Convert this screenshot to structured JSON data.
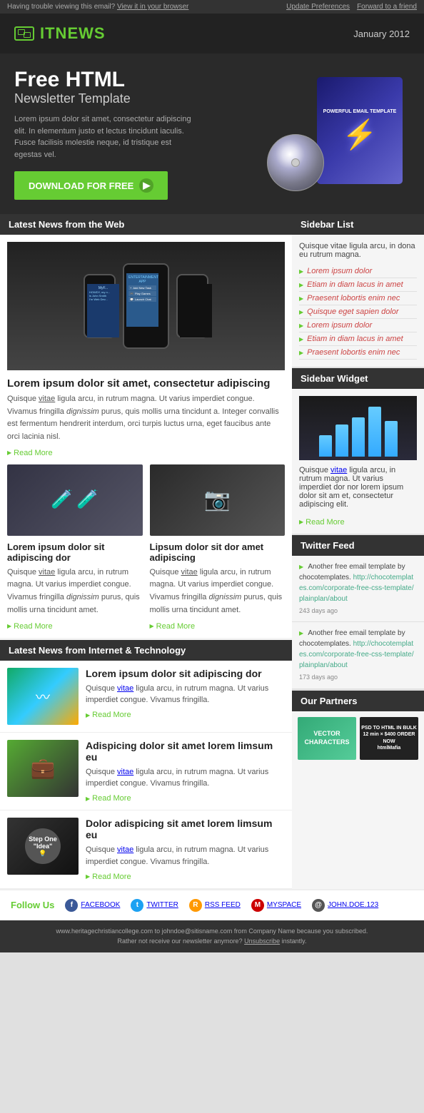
{
  "topBar": {
    "trouble_text": "Having trouble viewing this email?",
    "view_link": "View it in your browser",
    "update_link": "Update Preferences",
    "forward_link": "Forward to a friend"
  },
  "header": {
    "logo_text": "ITNEWS",
    "date": "January 2012"
  },
  "hero": {
    "title_line1": "Free HTML",
    "subtitle": "Newsletter Template",
    "description": "Lorem ipsum dolor sit amet, consectetur adipiscing elit. In elementum justo et lectus tincidunt iaculis. Fusce facilisis molestie neque, id tristique est egestas vel.",
    "button_label": "DOWNLOAD FOR FREE",
    "product_label": "POWERFUL EMAIL TEMPLATE"
  },
  "latestNews": {
    "section_title": "Latest News from the Web",
    "main_article": {
      "title": "Lorem ipsum dolor sit amet, consectetur adipiscing",
      "text": "Quisque vitae ligula arcu, in rutrum magna. Ut varius imperdiet congue. Vivamus fringilla dignissim purus, quis mollis urna tincidunt a. Integer convallis est fermentum hendrerit interdum, orci turpis luctus urna, eget faucibus ante orci lacinia nisl.",
      "read_more": "Read More",
      "vitae_link": "vitae"
    },
    "article1": {
      "title": "Lorem ipsum dolor sit adipiscing dor",
      "text": "Quisque vitae ligula arcu, in rutrum magna. Ut varius imperdiet congue. Vivamus fringilla dignissim purus, quis mollis urna tincidunt amet.",
      "read_more": "Read More",
      "vitae_link": "vitae"
    },
    "article2": {
      "title": "Lipsum dolor sit dor amet adipiscing",
      "text": "Quisque vitae ligula arcu, in rutrum magna. Ut varius imperdiet congue. Vivamus fringilla dignissim purus, quis mollis urna tincidunt amet.",
      "read_more": "Read More",
      "vitae_link": "vitae"
    }
  },
  "techNews": {
    "section_title": "Latest News from Internet & Technology",
    "article1": {
      "title": "Lorem ipsum dolor sit adipiscing dor",
      "text": "Quisque vitae ligula arcu, in rutrum magna. Ut varius imperdiet congue. Vivamus fringilla.",
      "read_more": "Read More",
      "vitae_link": "vitae"
    },
    "article2": {
      "title": "Adispicing dolor sit amet lorem limsum eu",
      "text": "Quisque vitae ligula arcu, in rutrum magna. Ut varius imperdiet congue. Vivamus fringilla.",
      "read_more": "Read More",
      "vitae_link": "vitae"
    },
    "article3": {
      "title": "Dolor adispicing sit amet lorem limsum eu",
      "text": "Quisque vitae ligula arcu, in rutrum magna. Ut varius imperdiet congue. Vivamus fringilla.",
      "read_more": "Read More",
      "vitae_link": "vitae"
    }
  },
  "sidebar": {
    "list_title": "Sidebar List",
    "list_intro": "Quisque vitae ligula arcu, in dona eu rutrum magna.",
    "list_items": [
      "Lorem ipsum dolor",
      "Etiam in diam lacus in amet",
      "Praesent lobortis enim nec",
      "Quisque eget sapien dolor",
      "Lorem ipsum dolor",
      "Etiam in diam lacus in amet",
      "Praesent lobortis enim nec"
    ],
    "widget_title": "Sidebar Widget",
    "widget_text": "Quisque vitae ligula arcu, in rutrum magna. Ut varius imperdiet dor nor lorem ipsum dolor sit am et, consectetur adipiscing elit.",
    "widget_read_more": "Read More",
    "widget_vitae": "vitae",
    "twitter_title": "Twitter Feed",
    "twitter_items": [
      {
        "text": "Another free email template by chocotemplates.",
        "link": "http://chocotemplates.com/corporate-free-css-template/plainplan/about",
        "time": "243 days ago"
      },
      {
        "text": "Another free email template by chocotemplates.",
        "link": "http://chocotemplates.com/corporate-free-css-template/plainplan/about",
        "time": "173 days ago"
      }
    ],
    "partners_title": "Our Partners",
    "partner1": "VECTOR CHARACTERS",
    "partner2": "PSD TO HTML IN BULK\n12 min × $400 ORDER NOW\nhtmlMafia"
  },
  "followUs": {
    "label": "Follow Us",
    "facebook": "FACEBOOK",
    "twitter": "TWITTER",
    "rss": "RSS FEED",
    "myspace": "MYSPACE",
    "email": "JOHN.DOE.123"
  },
  "footer": {
    "email": "www.heritagechristiancollege.com",
    "to": "to johndoe@sitisname.com",
    "from_text": "from Company Name because you subscribed.",
    "unsubscribe_text": "Rather not receive our newsletter anymore?",
    "unsubscribe_link": "Unsubscribe",
    "instantly": "instantly."
  }
}
